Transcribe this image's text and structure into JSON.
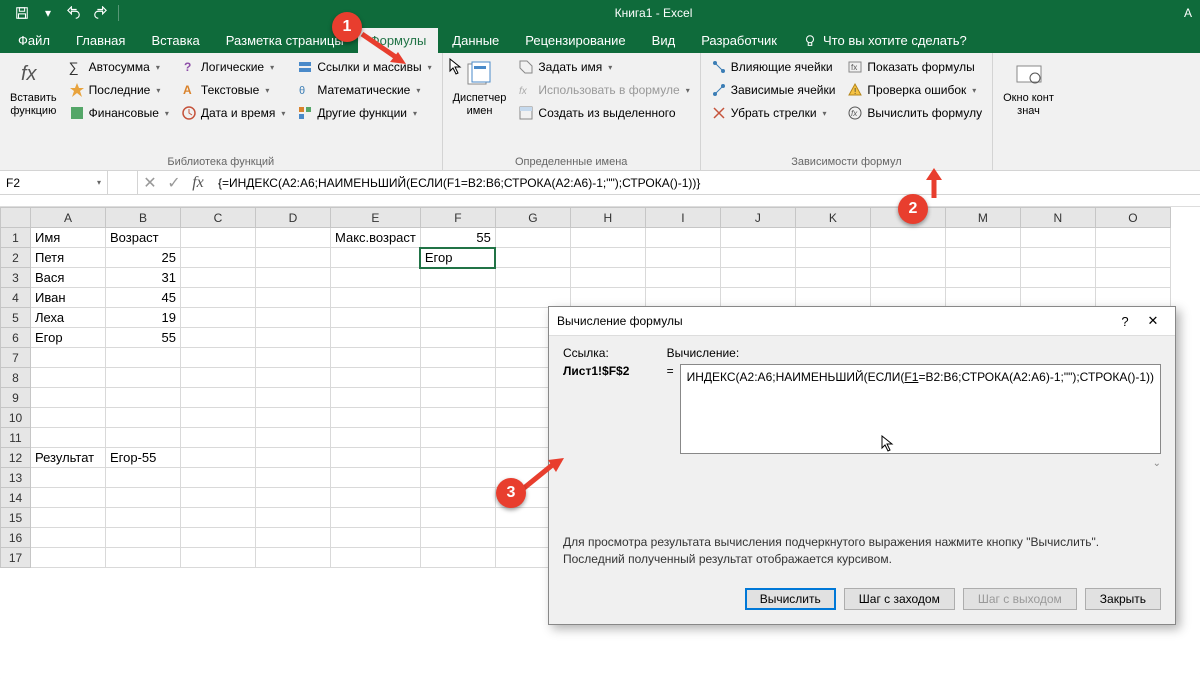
{
  "title": "Книга1  -  Excel",
  "title_right": "А",
  "tabs": {
    "file": "Файл",
    "home": "Главная",
    "insert": "Вставка",
    "layout": "Разметка страницы",
    "formulas": "Формулы",
    "data": "Данные",
    "review": "Рецензирование",
    "view": "Вид",
    "developer": "Разработчик",
    "tellme": "Что вы хотите сделать?"
  },
  "ribbon": {
    "insert_fn": "Вставить\nфункцию",
    "lib": {
      "autosum": "Автосумма",
      "recent": "Последние",
      "financial": "Финансовые",
      "logical": "Логические",
      "text": "Текстовые",
      "datetime": "Дата и время",
      "lookup": "Ссылки и массивы",
      "math": "Математические",
      "more": "Другие функции",
      "label": "Библиотека функций"
    },
    "names": {
      "manager": "Диспетчер\nимен",
      "define": "Задать имя",
      "use": "Использовать в формуле",
      "create": "Создать из выделенного",
      "label": "Определенные имена"
    },
    "audit": {
      "precedents": "Влияющие ячейки",
      "dependents": "Зависимые ячейки",
      "remove_arrows": "Убрать стрелки",
      "show_formulas": "Показать формулы",
      "error_check": "Проверка ошибок",
      "evaluate": "Вычислить формулу",
      "label": "Зависимости формул"
    },
    "watch": "Окно конт\nзнач"
  },
  "name_box": "F2",
  "formula": "{=ИНДЕКС(A2:A6;НАИМЕНЬШИЙ(ЕСЛИ(F1=B2:B6;СТРОКА(A2:A6)-1;\"\");СТРОКА()-1))}",
  "columns": [
    "A",
    "B",
    "C",
    "D",
    "E",
    "F",
    "G",
    "H",
    "I",
    "J",
    "K",
    "L",
    "M",
    "N",
    "O"
  ],
  "rows": [
    1,
    2,
    3,
    4,
    5,
    6,
    7,
    8,
    9,
    10,
    11,
    12,
    13,
    14,
    15,
    16,
    17
  ],
  "cells": {
    "A1": "Имя",
    "B1": "Возраст",
    "E1": "Макс.возраст",
    "F1": "55",
    "A2": "Петя",
    "B2": "25",
    "F2": "Егор",
    "A3": "Вася",
    "B3": "31",
    "A4": "Иван",
    "B4": "45",
    "A5": "Леха",
    "B5": "19",
    "A6": "Егор",
    "B6": "55",
    "A12": "Результат",
    "B12": "Егор-55"
  },
  "dialog": {
    "title": "Вычисление формулы",
    "ref_label": "Ссылка:",
    "ref_value": "Лист1!$F$2",
    "calc_label": "Вычисление:",
    "eq": "=",
    "formula_pre": "ИНДЕКС(A2:A6;НАИМЕНЬШИЙ(ЕСЛИ(",
    "formula_u": "F1",
    "formula_post": "=B2:B6;СТРОКА(A2:A6)-1;\"\");СТРОКА()-1))",
    "hint": "Для просмотра результата вычисления подчеркнутого выражения нажмите кнопку \"Вычислить\". Последний полученный результат отображается курсивом.",
    "btn_eval": "Вычислить",
    "btn_step_in": "Шаг с заходом",
    "btn_step_out": "Шаг с выходом",
    "btn_close": "Закрыть"
  },
  "callouts": {
    "c1": "1",
    "c2": "2",
    "c3": "3"
  }
}
